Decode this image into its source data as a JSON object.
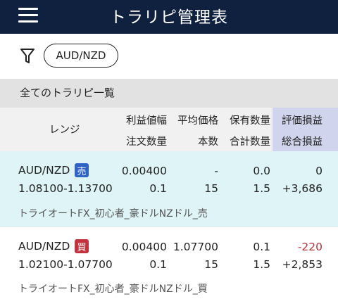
{
  "header": {
    "title": "トラリピ管理表",
    "menu_icon": "hamburger-menu-icon"
  },
  "filter": {
    "icon": "filter-funnel-icon",
    "selected_pair": "AUD/NZD"
  },
  "section": {
    "title": "全てのトラリピ一覧"
  },
  "columns": {
    "range": "レンジ",
    "profit_width": "利益値幅",
    "order_qty": "注文数量",
    "avg_price": "平均価格",
    "count": "本数",
    "position_qty": "保有数量",
    "total_qty": "合計数量",
    "unrealized_pl": "評価損益",
    "total_pl": "総合損益"
  },
  "rows": [
    {
      "pair": "AUD/NZD",
      "side": "売",
      "side_color": "#2f63c6",
      "profit_width": "0.00400",
      "avg_price": "-",
      "position_qty": "0.0",
      "unrealized_pl": "0",
      "range": "1.08100-1.13700",
      "order_qty": "0.1",
      "count": "15",
      "total_qty": "1.5",
      "total_pl": "+3,686",
      "strategy": "トライオートFX_初心者_豪ドルNZドル_売"
    },
    {
      "pair": "AUD/NZD",
      "side": "買",
      "side_color": "#c2333e",
      "profit_width": "0.00400",
      "avg_price": "1.07700",
      "position_qty": "0.1",
      "unrealized_pl": "-220",
      "range": "1.02100-1.07700",
      "order_qty": "0.1",
      "count": "15",
      "total_qty": "1.5",
      "total_pl": "+2,853",
      "strategy": "トライオートFX_初心者_豪ドルNZドル_買"
    }
  ],
  "colors": {
    "header_bg": "#10213f",
    "row_highlight": "#dff4f6",
    "pl_column": "#d0d4ec",
    "negative": "#b5343c"
  }
}
